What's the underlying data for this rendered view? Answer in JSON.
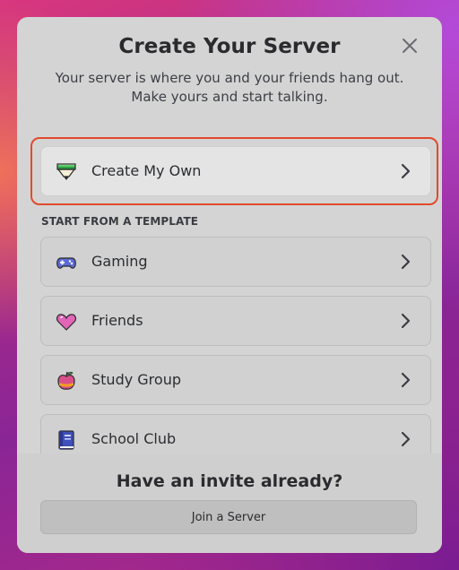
{
  "dialog": {
    "title": "Create Your Server",
    "subtitle": "Your server is where you and your friends hang out. Make yours and start talking.",
    "close_icon": "close-icon"
  },
  "create_own": {
    "label": "Create My Own",
    "icon": "pencil-icon"
  },
  "templates": {
    "section_label": "START FROM A TEMPLATE",
    "items": [
      {
        "label": "Gaming",
        "icon": "game-controller-icon"
      },
      {
        "label": "Friends",
        "icon": "heart-icon"
      },
      {
        "label": "Study Group",
        "icon": "apple-icon"
      },
      {
        "label": "School Club",
        "icon": "book-icon"
      }
    ]
  },
  "footer": {
    "title": "Have an invite already?",
    "join_label": "Join a Server"
  },
  "colors": {
    "highlight": "#e14a2c",
    "modal_bg": "#d4d4d4"
  }
}
